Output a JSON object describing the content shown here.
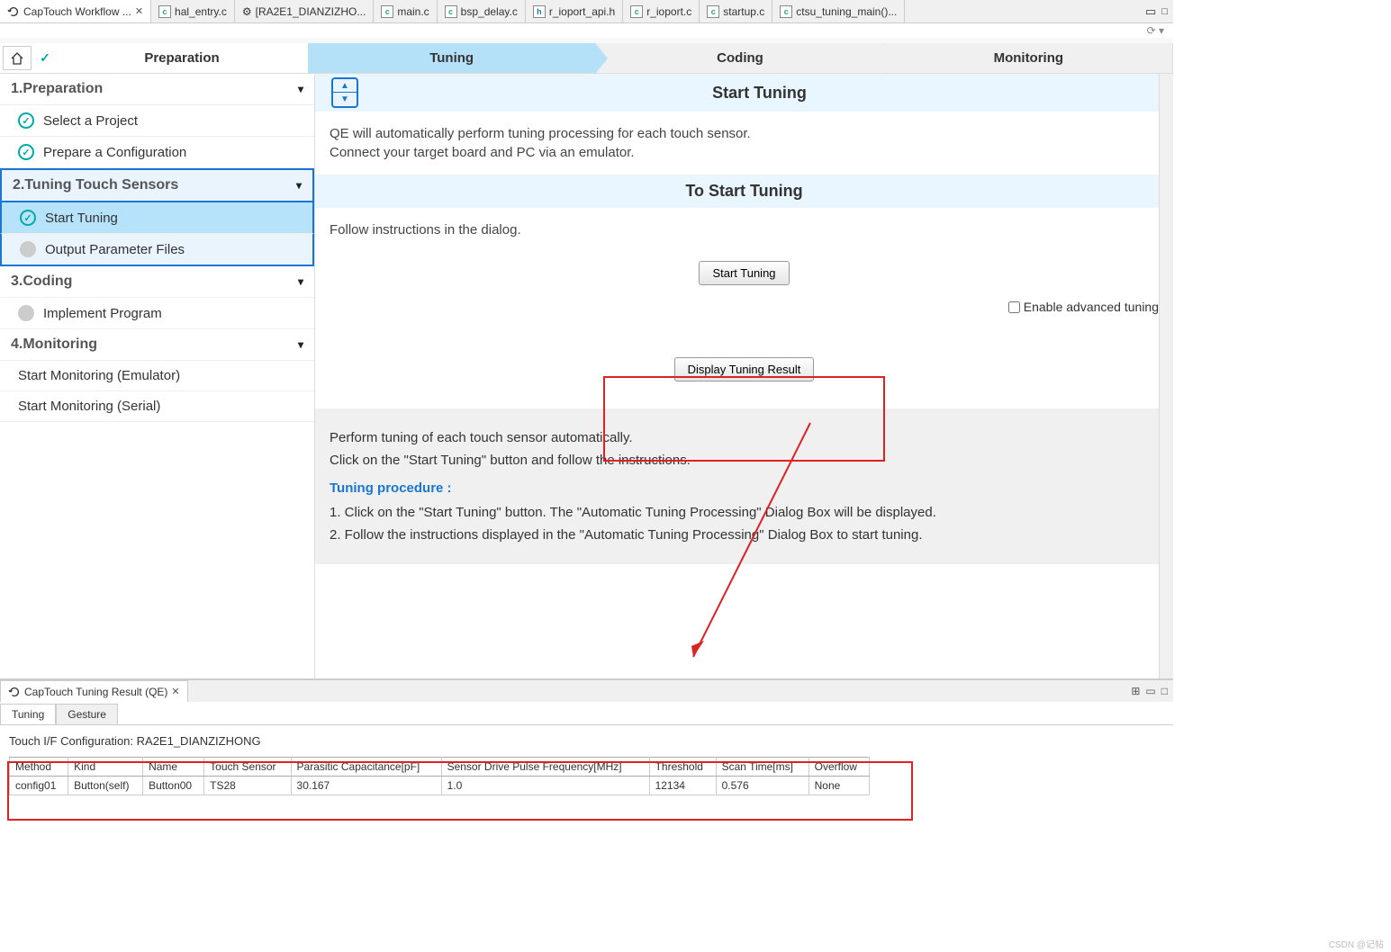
{
  "tabs": [
    {
      "label": "CapTouch Workflow ...",
      "icon": "loop",
      "active": true,
      "close": true
    },
    {
      "label": "hal_entry.c",
      "icon": "c"
    },
    {
      "label": "[RA2E1_DIANZIZHO...",
      "icon": "gear"
    },
    {
      "label": "main.c",
      "icon": "c"
    },
    {
      "label": "bsp_delay.c",
      "icon": "c"
    },
    {
      "label": "r_ioport_api.h",
      "icon": "h"
    },
    {
      "label": "r_ioport.c",
      "icon": "c"
    },
    {
      "label": "startup.c",
      "icon": "c"
    },
    {
      "label": "ctsu_tuning_main()...",
      "icon": "c"
    }
  ],
  "workflow_steps": {
    "prep": "Preparation",
    "tuning": "Tuning",
    "coding": "Coding",
    "monitoring": "Monitoring"
  },
  "sidebar": {
    "s1": {
      "title": "1.Preparation",
      "items": [
        "Select a Project",
        "Prepare a Configuration"
      ]
    },
    "s2": {
      "title": "2.Tuning Touch Sensors",
      "items": [
        "Start Tuning",
        "Output Parameter Files"
      ]
    },
    "s3": {
      "title": "3.Coding",
      "items": [
        "Implement Program"
      ]
    },
    "s4": {
      "title": "4.Monitoring",
      "items": [
        "Start Monitoring (Emulator)",
        "Start Monitoring (Serial)"
      ]
    }
  },
  "content": {
    "hdr1": "Start Tuning",
    "body1a": "QE will automatically perform tuning processing for each touch sensor.",
    "body1b": "Connect your target board and PC via an emulator.",
    "hdr2": "To Start Tuning",
    "body2": "Follow instructions in the dialog.",
    "btn_start": "Start Tuning",
    "chk_adv": "Enable advanced tuning",
    "btn_display": "Display Tuning Result",
    "grey1": "Perform tuning of each touch sensor automatically.",
    "grey2": "Click on the \"Start Tuning\" button and follow the instructions.",
    "proc_title": "Tuning procedure :",
    "proc_1": "1. Click on the \"Start Tuning\" button. The \"Automatic Tuning Processing\" Dialog Box will be displayed.",
    "proc_2": "2. Follow the instructions displayed in the \"Automatic Tuning Processing\" Dialog Box to start tuning."
  },
  "bottom": {
    "title": "CapTouch Tuning Result (QE)",
    "subtabs": {
      "tuning": "Tuning",
      "gesture": "Gesture"
    },
    "config_label": "Touch I/F Configuration: ",
    "config_value": "RA2E1_DIANZIZHONG",
    "headers": [
      "Method",
      "Kind",
      "Name",
      "Touch Sensor",
      "Parasitic Capacitance[pF]",
      "Sensor Drive Pulse Frequency[MHz]",
      "Threshold",
      "Scan Time[ms]",
      "Overflow"
    ],
    "row": [
      "config01",
      "Button(self)",
      "Button00",
      "TS28",
      "30.167",
      "1.0",
      "12134",
      "0.576",
      "None"
    ]
  },
  "watermark": "CSDN @记帖"
}
